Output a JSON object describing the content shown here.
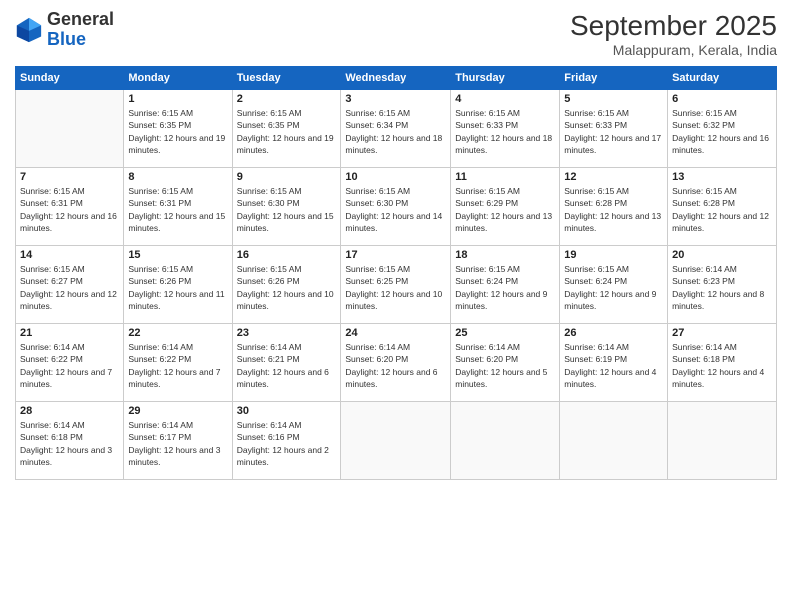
{
  "header": {
    "logo_line1": "General",
    "logo_line2": "Blue",
    "month": "September 2025",
    "location": "Malappuram, Kerala, India"
  },
  "days_of_week": [
    "Sunday",
    "Monday",
    "Tuesday",
    "Wednesday",
    "Thursday",
    "Friday",
    "Saturday"
  ],
  "weeks": [
    [
      {
        "day": "",
        "sunrise": "",
        "sunset": "",
        "daylight": ""
      },
      {
        "day": "1",
        "sunrise": "6:15 AM",
        "sunset": "6:35 PM",
        "daylight": "12 hours and 19 minutes."
      },
      {
        "day": "2",
        "sunrise": "6:15 AM",
        "sunset": "6:35 PM",
        "daylight": "12 hours and 19 minutes."
      },
      {
        "day": "3",
        "sunrise": "6:15 AM",
        "sunset": "6:34 PM",
        "daylight": "12 hours and 18 minutes."
      },
      {
        "day": "4",
        "sunrise": "6:15 AM",
        "sunset": "6:33 PM",
        "daylight": "12 hours and 18 minutes."
      },
      {
        "day": "5",
        "sunrise": "6:15 AM",
        "sunset": "6:33 PM",
        "daylight": "12 hours and 17 minutes."
      },
      {
        "day": "6",
        "sunrise": "6:15 AM",
        "sunset": "6:32 PM",
        "daylight": "12 hours and 16 minutes."
      }
    ],
    [
      {
        "day": "7",
        "sunrise": "6:15 AM",
        "sunset": "6:31 PM",
        "daylight": "12 hours and 16 minutes."
      },
      {
        "day": "8",
        "sunrise": "6:15 AM",
        "sunset": "6:31 PM",
        "daylight": "12 hours and 15 minutes."
      },
      {
        "day": "9",
        "sunrise": "6:15 AM",
        "sunset": "6:30 PM",
        "daylight": "12 hours and 15 minutes."
      },
      {
        "day": "10",
        "sunrise": "6:15 AM",
        "sunset": "6:30 PM",
        "daylight": "12 hours and 14 minutes."
      },
      {
        "day": "11",
        "sunrise": "6:15 AM",
        "sunset": "6:29 PM",
        "daylight": "12 hours and 13 minutes."
      },
      {
        "day": "12",
        "sunrise": "6:15 AM",
        "sunset": "6:28 PM",
        "daylight": "12 hours and 13 minutes."
      },
      {
        "day": "13",
        "sunrise": "6:15 AM",
        "sunset": "6:28 PM",
        "daylight": "12 hours and 12 minutes."
      }
    ],
    [
      {
        "day": "14",
        "sunrise": "6:15 AM",
        "sunset": "6:27 PM",
        "daylight": "12 hours and 12 minutes."
      },
      {
        "day": "15",
        "sunrise": "6:15 AM",
        "sunset": "6:26 PM",
        "daylight": "12 hours and 11 minutes."
      },
      {
        "day": "16",
        "sunrise": "6:15 AM",
        "sunset": "6:26 PM",
        "daylight": "12 hours and 10 minutes."
      },
      {
        "day": "17",
        "sunrise": "6:15 AM",
        "sunset": "6:25 PM",
        "daylight": "12 hours and 10 minutes."
      },
      {
        "day": "18",
        "sunrise": "6:15 AM",
        "sunset": "6:24 PM",
        "daylight": "12 hours and 9 minutes."
      },
      {
        "day": "19",
        "sunrise": "6:15 AM",
        "sunset": "6:24 PM",
        "daylight": "12 hours and 9 minutes."
      },
      {
        "day": "20",
        "sunrise": "6:14 AM",
        "sunset": "6:23 PM",
        "daylight": "12 hours and 8 minutes."
      }
    ],
    [
      {
        "day": "21",
        "sunrise": "6:14 AM",
        "sunset": "6:22 PM",
        "daylight": "12 hours and 7 minutes."
      },
      {
        "day": "22",
        "sunrise": "6:14 AM",
        "sunset": "6:22 PM",
        "daylight": "12 hours and 7 minutes."
      },
      {
        "day": "23",
        "sunrise": "6:14 AM",
        "sunset": "6:21 PM",
        "daylight": "12 hours and 6 minutes."
      },
      {
        "day": "24",
        "sunrise": "6:14 AM",
        "sunset": "6:20 PM",
        "daylight": "12 hours and 6 minutes."
      },
      {
        "day": "25",
        "sunrise": "6:14 AM",
        "sunset": "6:20 PM",
        "daylight": "12 hours and 5 minutes."
      },
      {
        "day": "26",
        "sunrise": "6:14 AM",
        "sunset": "6:19 PM",
        "daylight": "12 hours and 4 minutes."
      },
      {
        "day": "27",
        "sunrise": "6:14 AM",
        "sunset": "6:18 PM",
        "daylight": "12 hours and 4 minutes."
      }
    ],
    [
      {
        "day": "28",
        "sunrise": "6:14 AM",
        "sunset": "6:18 PM",
        "daylight": "12 hours and 3 minutes."
      },
      {
        "day": "29",
        "sunrise": "6:14 AM",
        "sunset": "6:17 PM",
        "daylight": "12 hours and 3 minutes."
      },
      {
        "day": "30",
        "sunrise": "6:14 AM",
        "sunset": "6:16 PM",
        "daylight": "12 hours and 2 minutes."
      },
      {
        "day": "",
        "sunrise": "",
        "sunset": "",
        "daylight": ""
      },
      {
        "day": "",
        "sunrise": "",
        "sunset": "",
        "daylight": ""
      },
      {
        "day": "",
        "sunrise": "",
        "sunset": "",
        "daylight": ""
      },
      {
        "day": "",
        "sunrise": "",
        "sunset": "",
        "daylight": ""
      }
    ]
  ]
}
